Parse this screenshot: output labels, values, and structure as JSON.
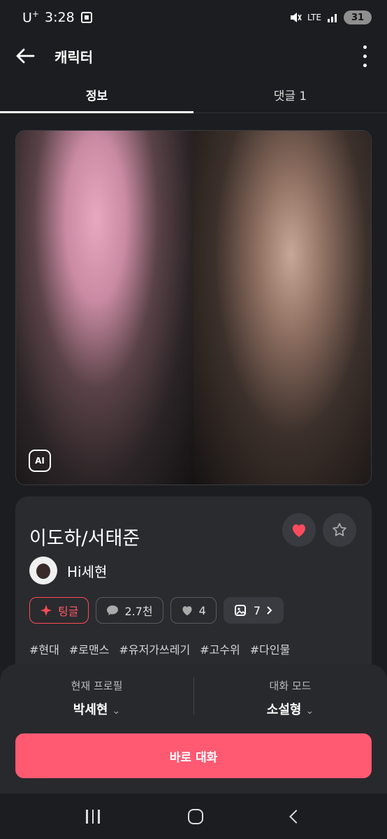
{
  "status_bar": {
    "carrier": "U",
    "carrier_sup": "+",
    "time": "3:28",
    "network": "LTE",
    "battery": "31"
  },
  "app_bar": {
    "title": "캐릭터"
  },
  "tabs": [
    {
      "label": "정보"
    },
    {
      "label": "댓글 1"
    }
  ],
  "hero": {
    "ai_badge": "AI"
  },
  "character": {
    "name": "이도하/서태준",
    "creator": "Hi세현",
    "chips": {
      "tingle": "팅글",
      "comments": "2.7천",
      "likes": "4",
      "gallery": "7"
    },
    "tags": [
      "#현대",
      "#로맨스",
      "#유저가쓰레기",
      "#고수위",
      "#다인물"
    ]
  },
  "bottom_sheet": {
    "profile_label": "현재 프로필",
    "profile_value": "박세현",
    "mode_label": "대화 모드",
    "mode_value": "소설형",
    "cta": "바로 대화"
  },
  "colors": {
    "accent": "#ff5a72",
    "tingle": "#ff4b55",
    "heart": "#ff4b5c"
  }
}
